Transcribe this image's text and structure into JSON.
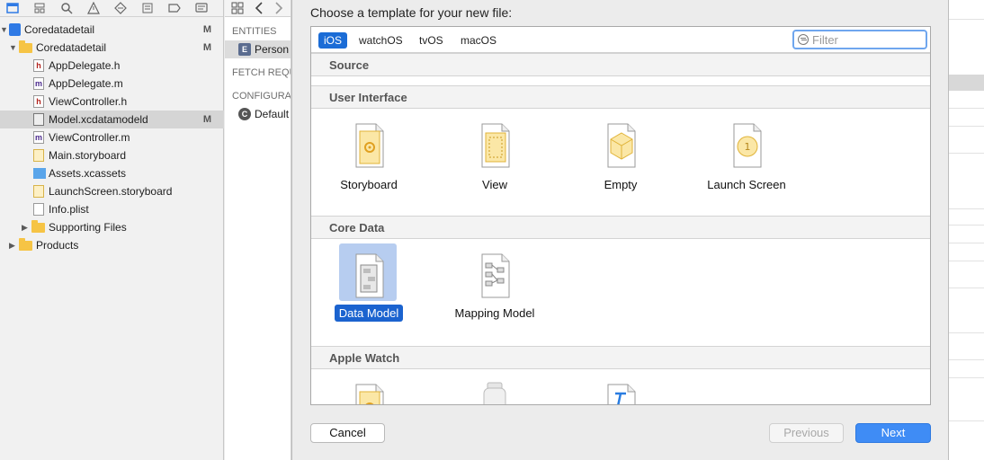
{
  "navigator": {
    "tree": [
      {
        "label": "Coredatadetail",
        "kind": "project",
        "badge": "M"
      },
      {
        "label": "Coredatadetail",
        "kind": "folder",
        "badge": "M"
      },
      {
        "label": "AppDelegate.h",
        "kind": "h",
        "badge": ""
      },
      {
        "label": "AppDelegate.m",
        "kind": "m",
        "badge": ""
      },
      {
        "label": "ViewController.h",
        "kind": "h",
        "badge": ""
      },
      {
        "label": "Model.xcdatamodeld",
        "kind": "model",
        "badge": "M"
      },
      {
        "label": "ViewController.m",
        "kind": "m",
        "badge": ""
      },
      {
        "label": "Main.storyboard",
        "kind": "story",
        "badge": ""
      },
      {
        "label": "Assets.xcassets",
        "kind": "assets",
        "badge": ""
      },
      {
        "label": "LaunchScreen.storyboard",
        "kind": "story",
        "badge": ""
      },
      {
        "label": "Info.plist",
        "kind": "plist",
        "badge": ""
      },
      {
        "label": "Supporting Files",
        "kind": "folder",
        "badge": ""
      },
      {
        "label": "Products",
        "kind": "folder",
        "badge": ""
      }
    ],
    "selected_index": 5
  },
  "editor": {
    "entities_header": "ENTITIES",
    "entity": "Person",
    "entity_badge": "E",
    "fetch_header": "FETCH REQU",
    "config_header": "CONFIGURA",
    "config": "Default",
    "config_badge": "C"
  },
  "sheet": {
    "title": "Choose a template for your new file:",
    "platforms": [
      "iOS",
      "watchOS",
      "tvOS",
      "macOS"
    ],
    "active_platform": "iOS",
    "filter_placeholder": "Filter",
    "sections": {
      "source": "Source",
      "user_interface": "User Interface",
      "core_data": "Core Data",
      "apple_watch": "Apple Watch"
    },
    "ui_templates": [
      "Storyboard",
      "View",
      "Empty",
      "Launch Screen"
    ],
    "core_data_templates": [
      "Data Model",
      "Mapping Model"
    ],
    "selected_template": "Data Model",
    "buttons": {
      "cancel": "Cancel",
      "previous": "Previous",
      "next": "Next"
    }
  },
  "colors": {
    "accent": "#1b63cf",
    "primary_button": "#3f8cf5",
    "selection_bg": "#b7cdf0"
  }
}
